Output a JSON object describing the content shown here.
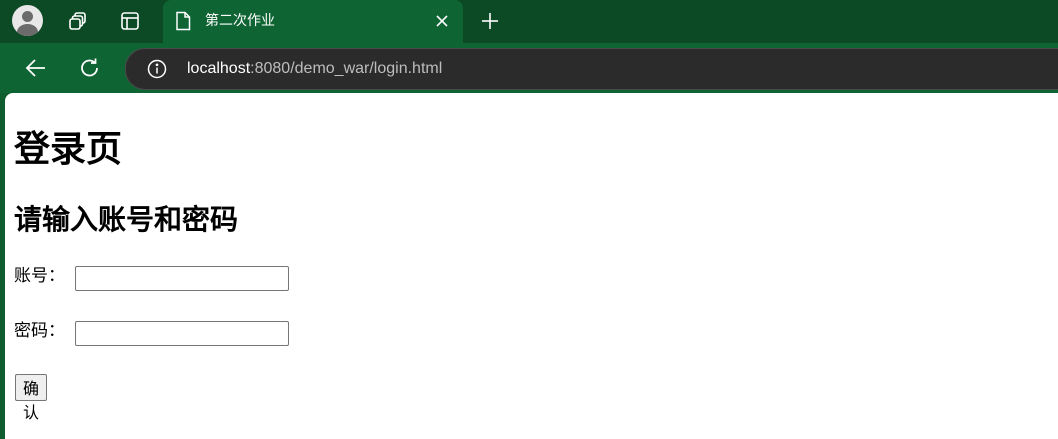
{
  "browser": {
    "tab": {
      "title": "第二次作业"
    },
    "address_bar": {
      "host": "localhost",
      "rest": ":8080/demo_war/login.html"
    },
    "colors": {
      "tabstrip": "#0b4a25",
      "toolbar": "#0f6434",
      "omnibox": "#2b2b2b"
    }
  },
  "page": {
    "heading": "登录页",
    "subheading": "请输入账号和密码",
    "form": {
      "account_label": "账号：",
      "account_value": "",
      "password_label": "密码：",
      "password_value": "",
      "submit_label": "确认"
    }
  },
  "icons": {
    "profile": "profile-avatar-icon",
    "workspaces": "workspaces-icon",
    "tab_actions": "tab-actions-icon",
    "document": "document-icon",
    "close": "close-icon",
    "new_tab": "plus-icon",
    "back": "back-arrow-icon",
    "reload": "reload-icon",
    "site_info": "info-icon"
  }
}
